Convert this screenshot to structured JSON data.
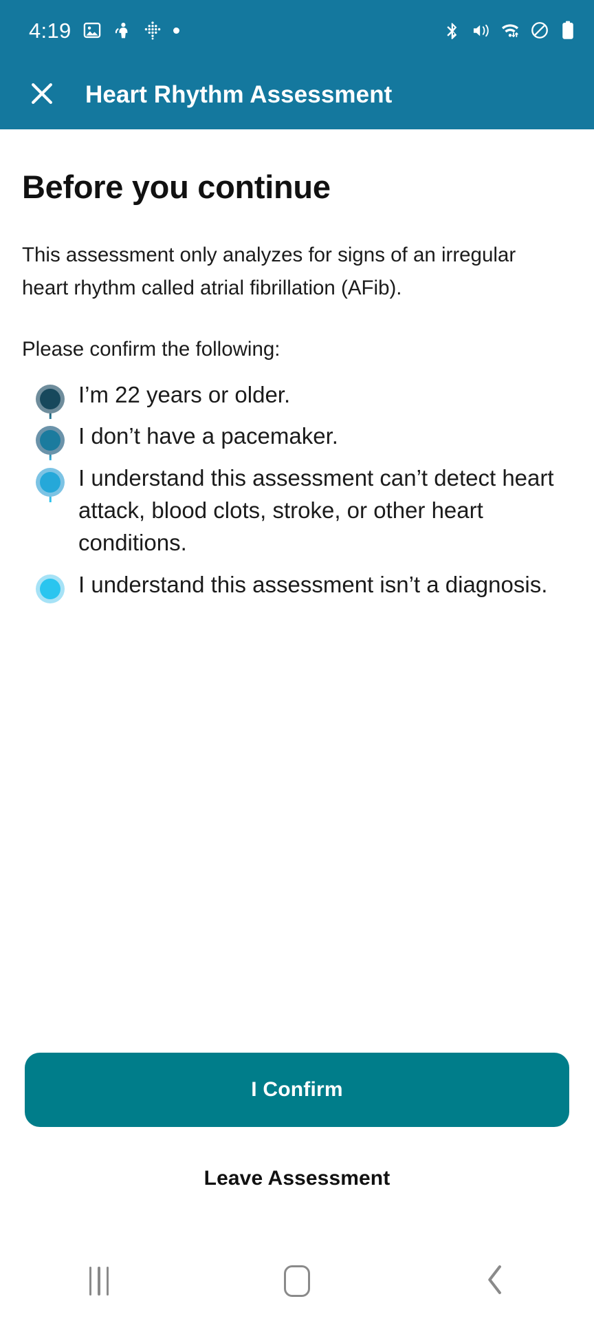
{
  "status_bar": {
    "time": "4:19",
    "left_icons": [
      "image-icon",
      "person-alert-icon",
      "dots-grid-icon",
      "small-dot-icon"
    ],
    "right_icons": [
      "bluetooth-icon",
      "volume-mute-vibrate-icon",
      "wifi-data-icon",
      "do-not-disturb-icon",
      "battery-icon"
    ],
    "background_color": "#14789e",
    "foreground_color": "#ffffff"
  },
  "app_bar": {
    "close_label": "close-icon",
    "title": "Heart Rhythm Assessment",
    "background_color": "#14789e"
  },
  "main": {
    "page_title": "Before you continue",
    "intro_paragraph": "This assessment only analyzes for signs of an irregular heart rhythm called atrial fibrillation (AFib).",
    "confirm_lead": "Please confirm the following:",
    "checklist": [
      {
        "text": "I’m 22 years or older.",
        "ring_color": "#6f8d9c",
        "dot_color": "#17485c",
        "line_color": "#1d5568"
      },
      {
        "text": "I don’t have a pacemaker.",
        "ring_color": "#6b93aa",
        "dot_color": "#1b7b9e",
        "line_color": "#2a7e9c"
      },
      {
        "text": "I understand this assessment can’t detect heart attack, blood clots, stroke, or other heart conditions.",
        "ring_color": "#7cc3e4",
        "dot_color": "#25a8d9",
        "line_color": "#39b4e0"
      },
      {
        "text": "I understand this assessment isn’t a diagnosis.",
        "ring_color": "#a6e2f6",
        "dot_color": "#2ac5ef",
        "line_color": "#2ac5ef"
      }
    ]
  },
  "actions": {
    "confirm_label": "I Confirm",
    "confirm_color": "#007d8a",
    "leave_label": "Leave Assessment"
  },
  "nav_bar": {
    "recents_label": "recents-icon",
    "home_label": "home-icon",
    "back_label": "back-icon",
    "icon_color": "#8a8a8a"
  }
}
